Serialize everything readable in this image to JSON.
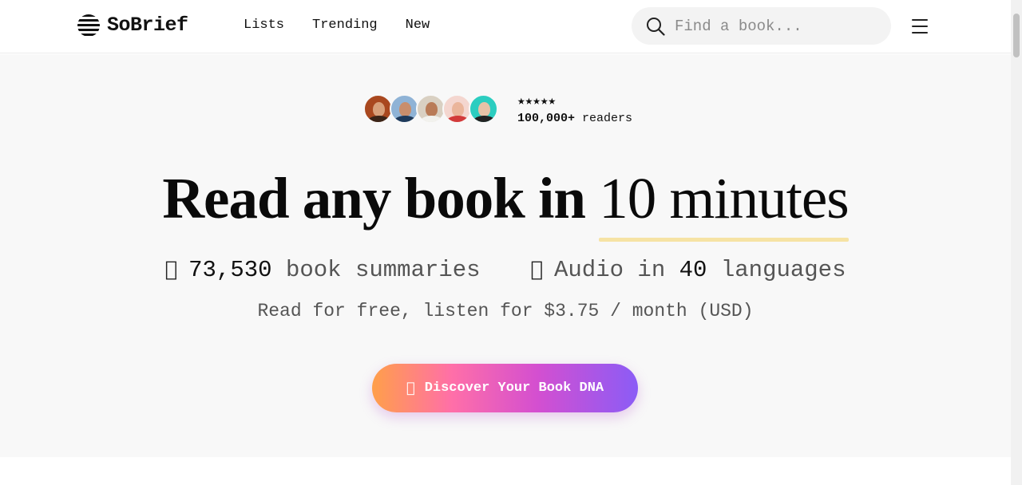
{
  "header": {
    "logo_text": "SoBrief",
    "nav": [
      {
        "label": "Lists"
      },
      {
        "label": "Trending"
      },
      {
        "label": "New"
      }
    ],
    "search": {
      "placeholder": "Find a book...",
      "value": ""
    }
  },
  "hero": {
    "social_proof": {
      "stars": "★★★★★",
      "rating_stars": 5,
      "readers_count": "100,000+",
      "readers_label": "readers"
    },
    "headline": {
      "bold": "Read any book in",
      "highlight": "10 minutes"
    },
    "stats": {
      "summaries_icon": "book-icon",
      "summaries_count": "73,530",
      "summaries_label": "book summaries",
      "audio_icon": "headphones-icon",
      "audio_prefix": "Audio in",
      "audio_count": "40",
      "audio_suffix": "languages"
    },
    "pricing": "Read for free, listen for $3.75 / month (USD)",
    "cta": {
      "label": "Discover Your Book DNA",
      "icon": "dna-icon"
    }
  },
  "colors": {
    "star": "#f5a623",
    "highlight_underline": "#f6e3a4",
    "cta_gradient": [
      "#ff9f4a",
      "#ff6fa8",
      "#d44fd0",
      "#8b5cf6"
    ],
    "hero_background": "#f8f8f8"
  }
}
